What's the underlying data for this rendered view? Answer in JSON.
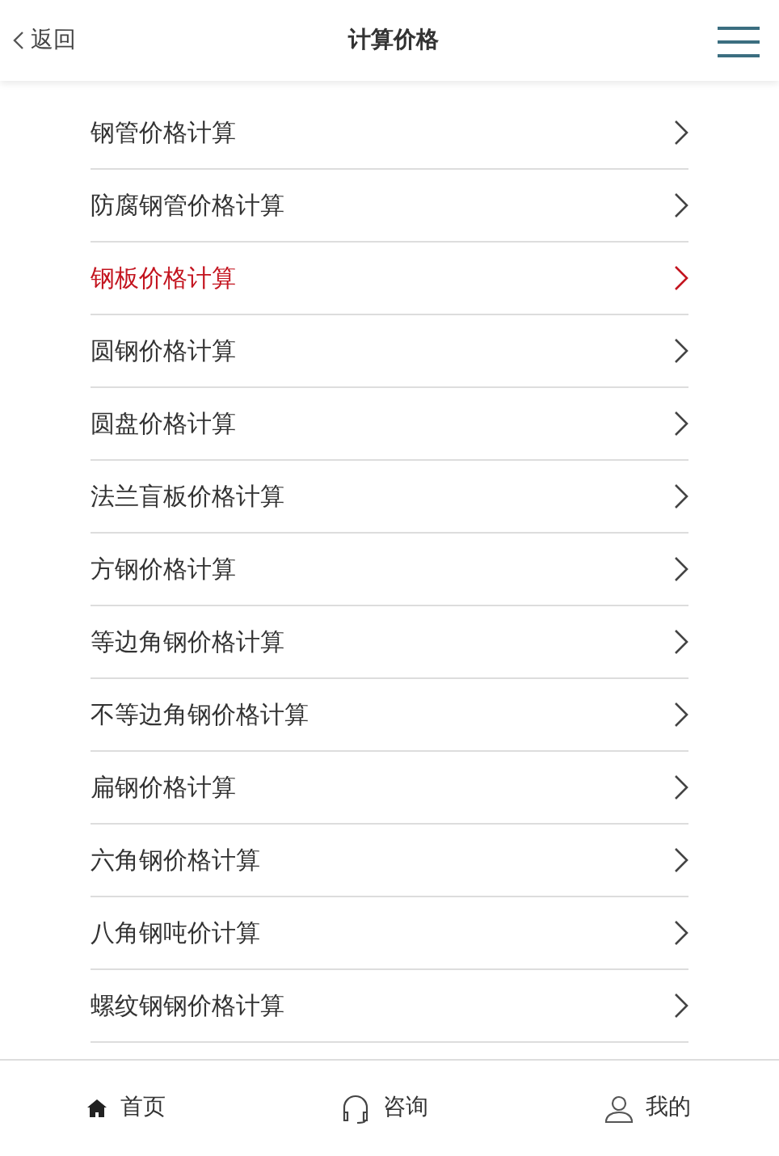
{
  "header": {
    "back": "返回",
    "title": "计算价格"
  },
  "items": [
    {
      "label": "钢管价格计算",
      "selected": false
    },
    {
      "label": "防腐钢管价格计算",
      "selected": false
    },
    {
      "label": "钢板价格计算",
      "selected": true
    },
    {
      "label": "圆钢价格计算",
      "selected": false
    },
    {
      "label": "圆盘价格计算",
      "selected": false
    },
    {
      "label": "法兰盲板价格计算",
      "selected": false
    },
    {
      "label": "方钢价格计算",
      "selected": false
    },
    {
      "label": "等边角钢价格计算",
      "selected": false
    },
    {
      "label": "不等边角钢价格计算",
      "selected": false
    },
    {
      "label": "扁钢价格计算",
      "selected": false
    },
    {
      "label": "六角钢价格计算",
      "selected": false
    },
    {
      "label": "八角钢吨价计算",
      "selected": false
    },
    {
      "label": "螺纹钢钢价格计算",
      "selected": false
    }
  ],
  "tabbar": [
    {
      "kind": "home",
      "label": "首页"
    },
    {
      "kind": "consult",
      "label": "咨询"
    },
    {
      "kind": "user",
      "label": "我的"
    }
  ]
}
